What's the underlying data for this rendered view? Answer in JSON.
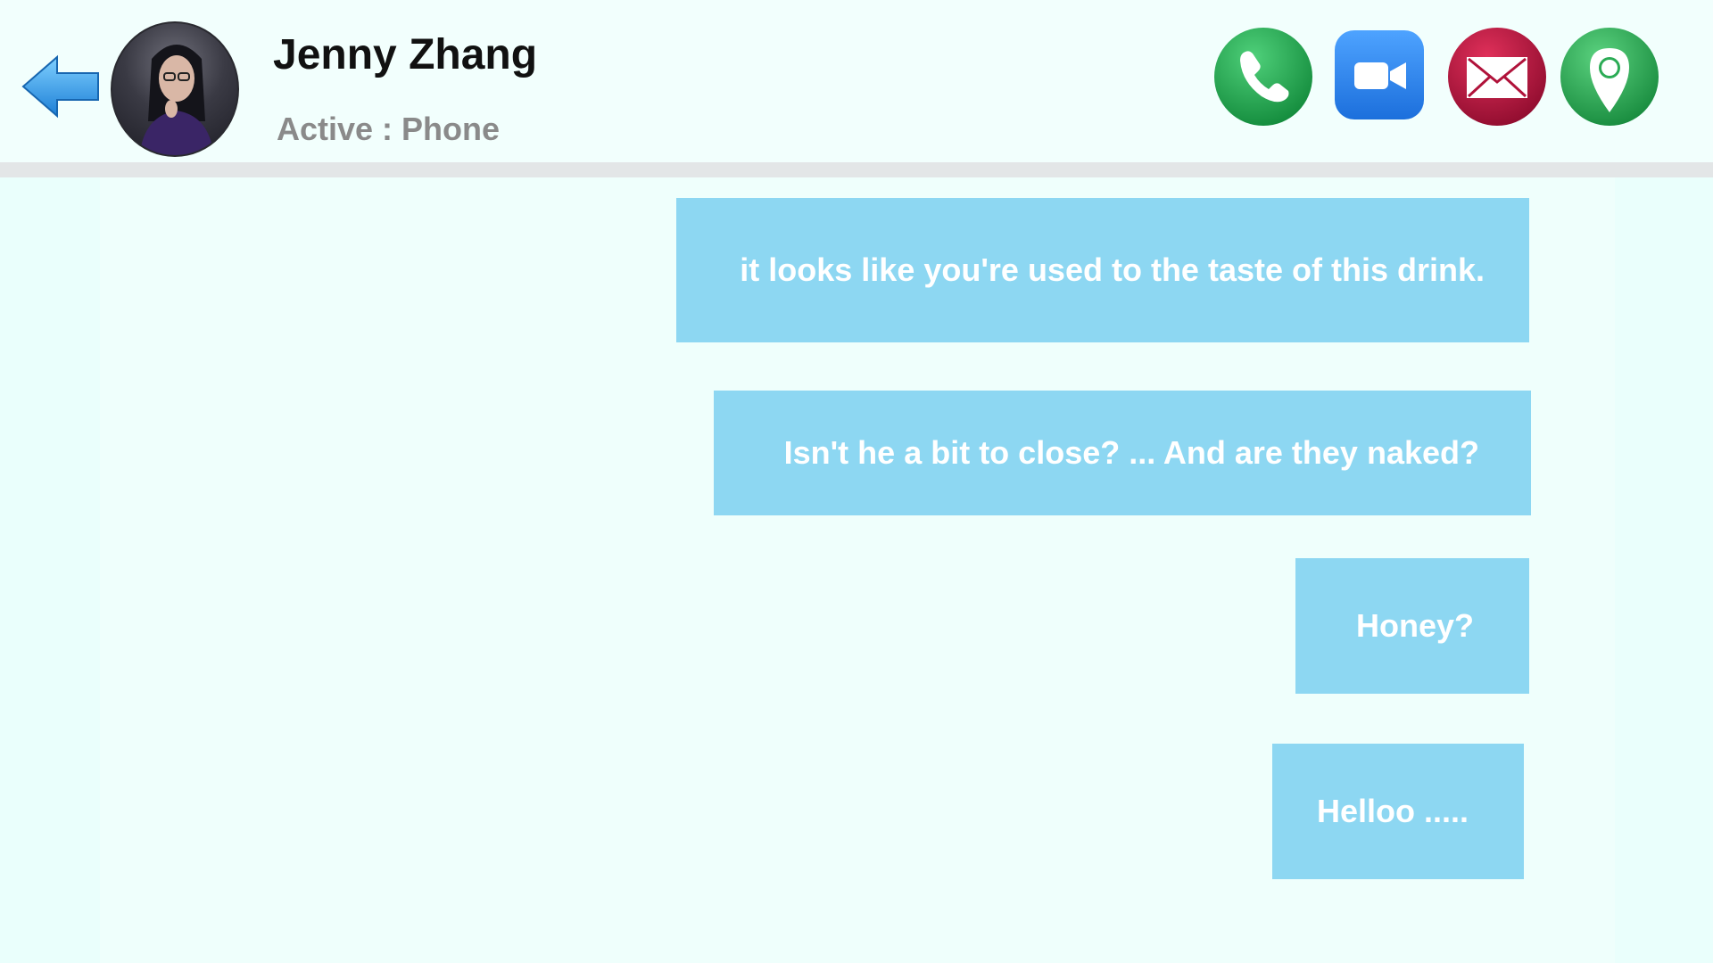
{
  "header": {
    "contact_name": "Jenny Zhang",
    "status": "Active : Phone"
  },
  "icons": {
    "back": "back-arrow-icon",
    "phone": "phone-icon",
    "video": "video-camera-icon",
    "mail": "envelope-icon",
    "location": "location-pin-icon"
  },
  "colors": {
    "background": "#eafffc",
    "bubble": "#8dd7f2",
    "phone_green": "#1fa84f",
    "video_blue": "#2d86ec",
    "mail_red": "#b0123a",
    "location_green": "#24a04a"
  },
  "messages": [
    {
      "text": "it looks like you're used to the taste of this drink."
    },
    {
      "text": "Isn't he a bit to close? ... And are they naked?"
    },
    {
      "text": "Honey?"
    },
    {
      "text": "Helloo ....."
    }
  ]
}
